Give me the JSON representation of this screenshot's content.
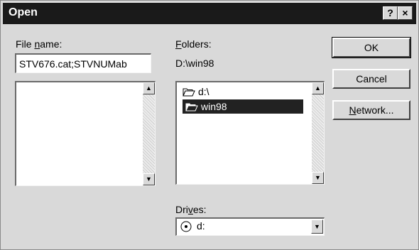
{
  "window": {
    "title": "Open",
    "help_label": "?",
    "close_label": "×"
  },
  "file_name": {
    "label": "File name:",
    "label_before": "File ",
    "label_access": "n",
    "label_after": "ame:",
    "value": "STV676.cat;STVNUMab",
    "files": []
  },
  "folders": {
    "label_access": "F",
    "label_rest": "olders:",
    "current_path": "D:\\win98",
    "items": [
      {
        "name": "d:\\",
        "icon": "open-folder-icon",
        "selected": false
      },
      {
        "name": "win98",
        "icon": "open-folder-icon",
        "selected": true
      }
    ]
  },
  "drives": {
    "label_before": "Dri",
    "label_access": "v",
    "label_after": "es:",
    "selected": "d:",
    "icon": "cd-drive-icon"
  },
  "buttons": {
    "ok": "OK",
    "cancel": "Cancel",
    "network_access": "N",
    "network_rest": "etwork..."
  },
  "scroll_arrows": {
    "up": "▲",
    "down": "▼"
  },
  "colors": {
    "titlebar": "#1a1a1a",
    "dialog_face": "#d9d9d9",
    "selection": "#222222"
  }
}
